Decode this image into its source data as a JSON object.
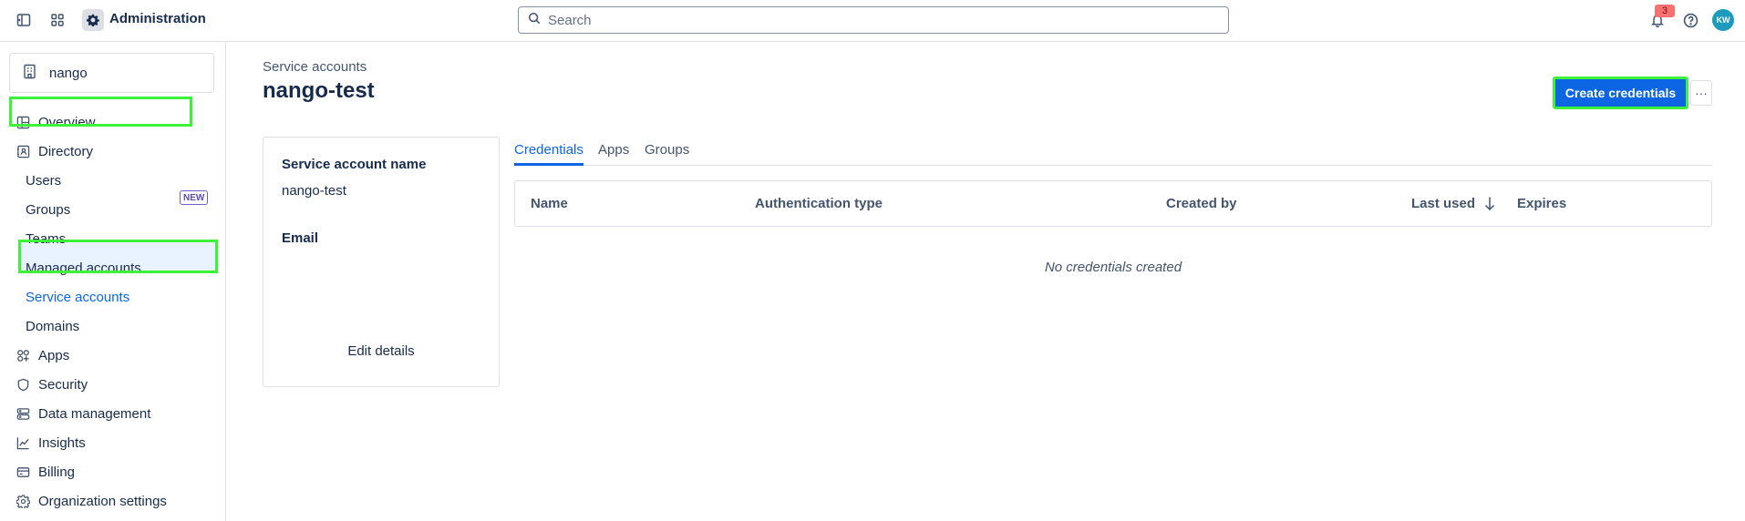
{
  "topbar": {
    "app_title": "Administration",
    "search_placeholder": "Search",
    "notifications_count": "3",
    "avatar_initials": "KW"
  },
  "sidebar": {
    "org_name": "nango",
    "items": {
      "overview": "Overview",
      "directory": "Directory",
      "users": "Users",
      "groups": "Groups",
      "teams": "Teams",
      "teams_badge": "NEW",
      "managed_accounts": "Managed accounts",
      "service_accounts": "Service accounts",
      "domains": "Domains",
      "apps": "Apps",
      "security": "Security",
      "data_management": "Data management",
      "insights": "Insights",
      "billing": "Billing",
      "organization_settings": "Organization settings"
    },
    "selected": "service_accounts"
  },
  "main": {
    "breadcrumb": "Service accounts",
    "title": "nango-test",
    "create_button": "Create credentials",
    "more_button": "···",
    "details": {
      "name_label": "Service account name",
      "name_value": "nango-test",
      "email_label": "Email",
      "email_value": "",
      "edit_label": "Edit details"
    },
    "tabs": [
      "Credentials",
      "Apps",
      "Groups"
    ],
    "active_tab": "Credentials",
    "table": {
      "columns": [
        "Name",
        "Authentication type",
        "Created by",
        "Last used",
        "Expires"
      ],
      "sort_column": "Last used",
      "sort_direction": "descending",
      "empty_message": "No credentials created"
    }
  },
  "colors": {
    "accent": "#0c66e4",
    "highlight": "#3ef23a",
    "selected_bg": "#e9f2ff",
    "notification": "#f87171",
    "avatar": "#1d9bbd"
  }
}
